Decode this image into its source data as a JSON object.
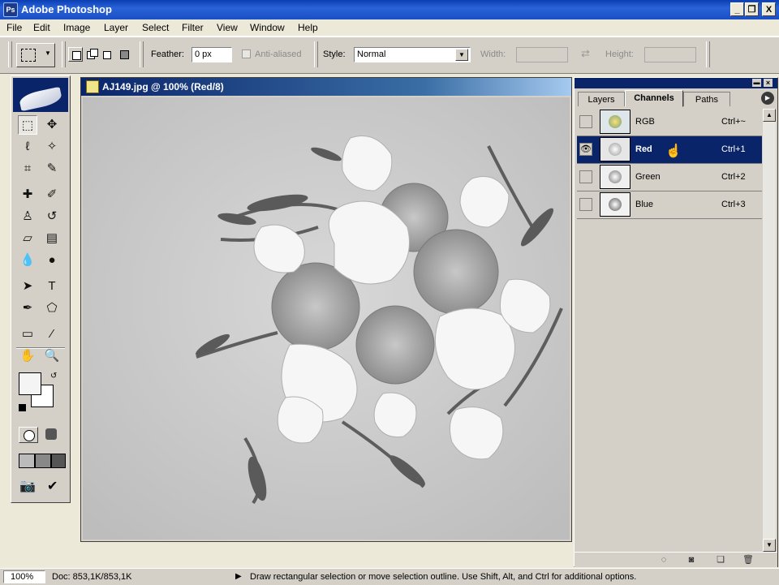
{
  "app": {
    "title": "Adobe Photoshop",
    "icon": "photoshop-app-icon"
  },
  "window_buttons": {
    "minimize": "_",
    "restore": "❐",
    "close": "X"
  },
  "menu": [
    "File",
    "Edit",
    "Image",
    "Layer",
    "Select",
    "Filter",
    "View",
    "Window",
    "Help"
  ],
  "options": {
    "feather_label": "Feather:",
    "feather_value": "0 px",
    "antialiased_label": "Anti-aliased",
    "style_label": "Style:",
    "style_value": "Normal",
    "width_label": "Width:",
    "height_label": "Height:",
    "width_value": "",
    "height_value": ""
  },
  "toolbox": {
    "tools": [
      [
        "marquee-tool",
        "⬚"
      ],
      [
        "move-tool",
        "✥"
      ],
      [
        "lasso-tool",
        "ℓ"
      ],
      [
        "magic-wand-tool",
        "✧"
      ],
      [
        "crop-tool",
        "⌗"
      ],
      [
        "slice-tool",
        "✎"
      ],
      [
        "healing-brush-tool",
        "✚"
      ],
      [
        "brush-tool",
        "✐"
      ],
      [
        "clone-stamp-tool",
        "♙"
      ],
      [
        "history-brush-tool",
        "↺"
      ],
      [
        "eraser-tool",
        "▱"
      ],
      [
        "gradient-tool",
        "▤"
      ],
      [
        "blur-tool",
        "💧"
      ],
      [
        "dodge-tool",
        "●"
      ],
      [
        "path-selection-tool",
        "➤"
      ],
      [
        "type-tool",
        "T"
      ],
      [
        "pen-tool",
        "✒"
      ],
      [
        "shape-tool",
        "⬠"
      ],
      [
        "notes-tool",
        "▭"
      ],
      [
        "eyedropper-tool",
        "⁄"
      ],
      [
        "hand-tool",
        "✋"
      ],
      [
        "zoom-tool",
        "🔍"
      ]
    ]
  },
  "document": {
    "title": "AJ149.jpg @ 100% (Red/8)"
  },
  "panel": {
    "tabs": [
      "Layers",
      "Channels",
      "Paths"
    ],
    "active_tab": "Channels",
    "channels": [
      {
        "name": "RGB",
        "shortcut": "Ctrl+~",
        "visible": false,
        "selected": false
      },
      {
        "name": "Red",
        "shortcut": "Ctrl+1",
        "visible": true,
        "selected": true
      },
      {
        "name": "Green",
        "shortcut": "Ctrl+2",
        "visible": false,
        "selected": false
      },
      {
        "name": "Blue",
        "shortcut": "Ctrl+3",
        "visible": false,
        "selected": false
      }
    ]
  },
  "status": {
    "zoom": "100%",
    "doc": "Doc: 853,1K/853,1K",
    "message": "Draw rectangular selection or move selection outline.  Use Shift, Alt, and Ctrl for additional options."
  },
  "colors": {
    "titlebar": "#0a3fb3",
    "selection": "#0a246a",
    "chrome": "#d4d0c8"
  }
}
